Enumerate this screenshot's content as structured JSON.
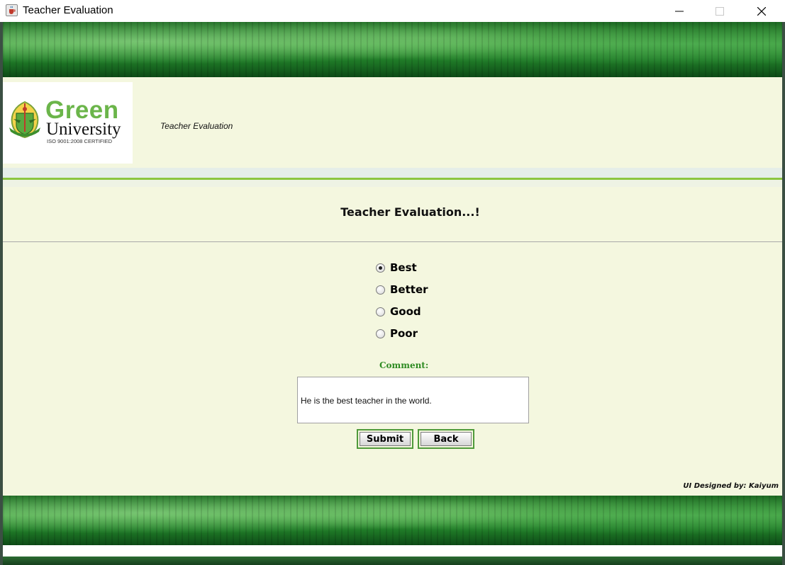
{
  "window": {
    "title": "Teacher Evaluation",
    "app_icon": "java-cup-icon"
  },
  "header": {
    "logo": {
      "word1": "Green",
      "word2": "University",
      "tagline": "ISO 9001:2008 CERTIFIED",
      "emblem_text": "Green University"
    },
    "caption": "Teacher  Evaluation"
  },
  "main": {
    "heading": "Teacher Evaluation...!",
    "rating_options": [
      {
        "label": "Best",
        "selected": true
      },
      {
        "label": "Better",
        "selected": false
      },
      {
        "label": "Good",
        "selected": false
      },
      {
        "label": "Poor",
        "selected": false
      }
    ],
    "comment_label": "Comment:",
    "comment_value": "He is the best teacher in the world.",
    "submit_label": "Submit",
    "back_label": "Back"
  },
  "footer": {
    "credit": "UI Designed by: Kaiyum"
  },
  "colors": {
    "background": "#f4f7df",
    "accent_green": "#8cc63f",
    "logo_green": "#6bb54a",
    "comment_label": "#2e8b22"
  }
}
